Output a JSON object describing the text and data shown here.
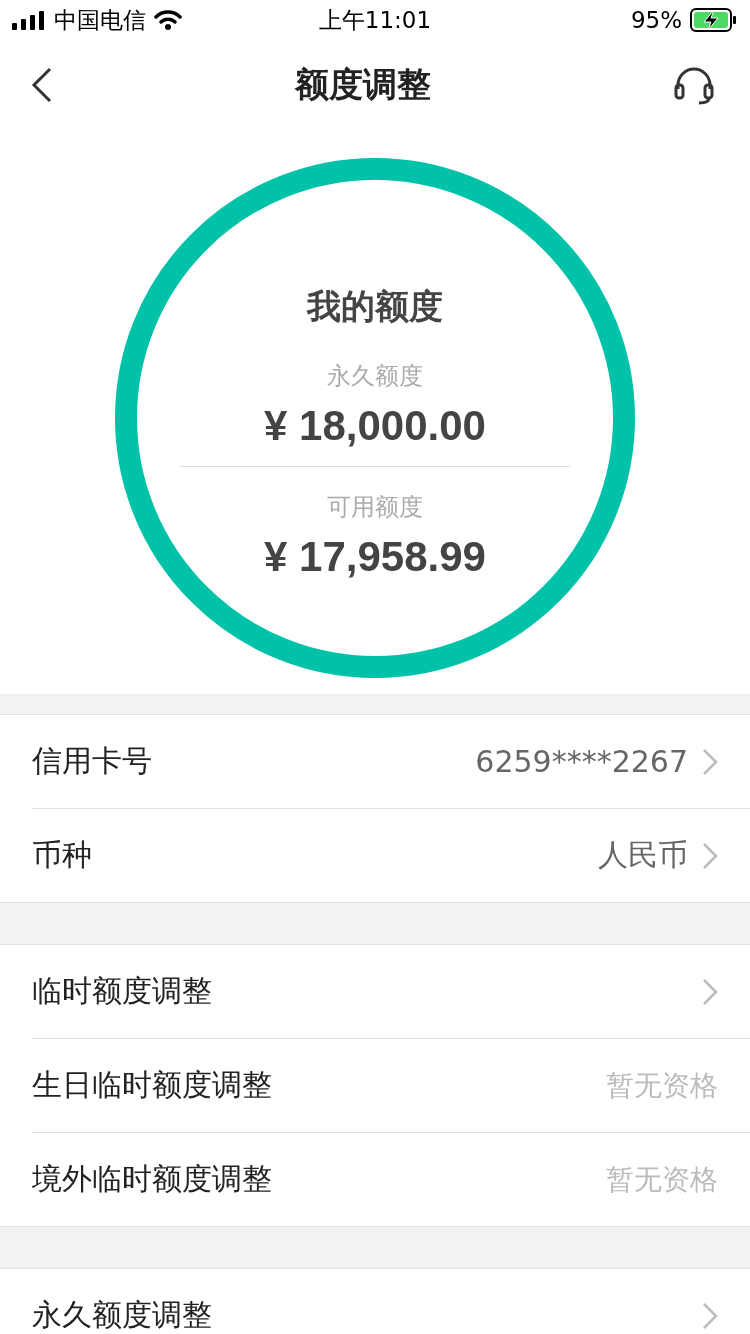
{
  "status_bar": {
    "carrier": "中国电信",
    "time": "上午11:01",
    "battery": "95%",
    "charging": true
  },
  "nav": {
    "title": "额度调整"
  },
  "quota": {
    "title": "我的额度",
    "items": [
      {
        "label": "永久额度",
        "amount": "¥ 18,000.00"
      },
      {
        "label": "可用额度",
        "amount": "¥ 17,958.99"
      }
    ]
  },
  "groups": [
    {
      "rows": [
        {
          "kind": "link",
          "label": "信用卡号",
          "value": "6259****2267"
        },
        {
          "kind": "link",
          "label": "币种",
          "value": "人民币"
        }
      ]
    },
    {
      "rows": [
        {
          "kind": "link",
          "label": "临时额度调整"
        },
        {
          "kind": "info",
          "label": "生日临时额度调整",
          "value": "暂无资格"
        },
        {
          "kind": "info",
          "label": "境外临时额度调整",
          "value": "暂无资格"
        }
      ]
    },
    {
      "rows": [
        {
          "kind": "link",
          "label": "永久额度调整"
        }
      ]
    }
  ]
}
